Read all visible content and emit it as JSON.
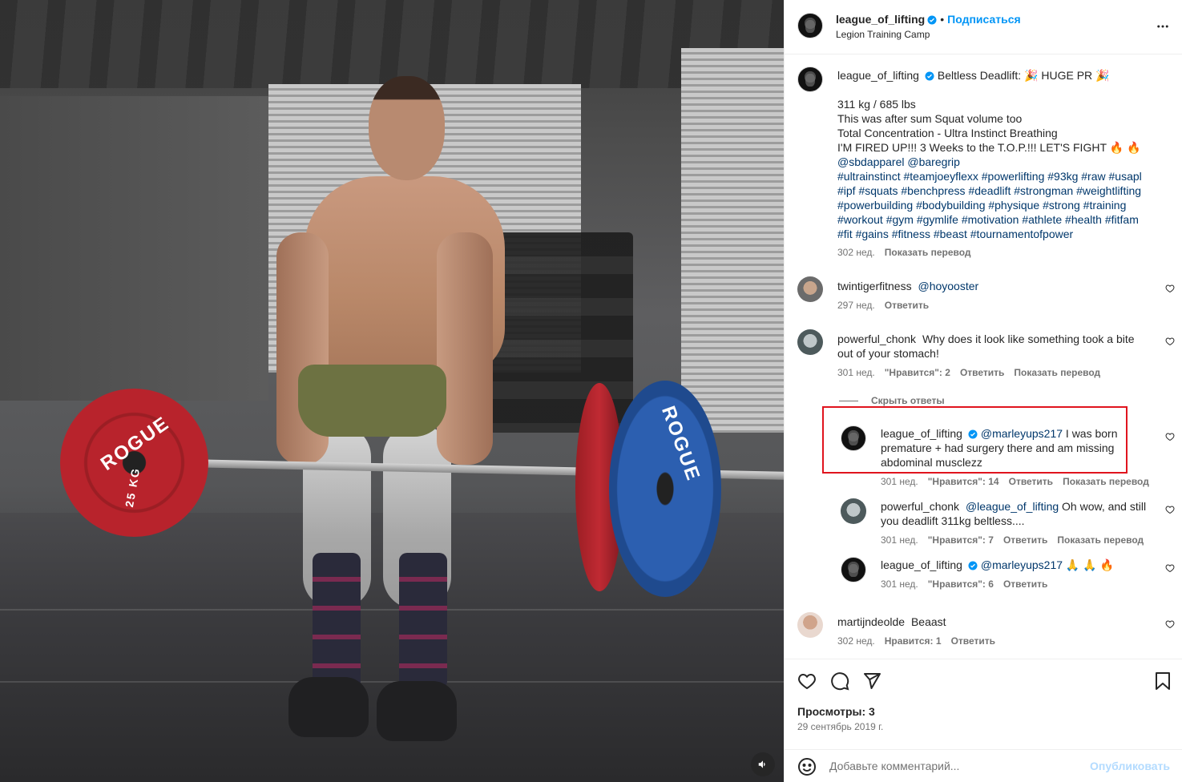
{
  "post": {
    "author": "league_of_lifting",
    "follow_label": "Подписаться",
    "location": "Legion Training Camp",
    "media_alt": "Video of a man deadlifting a barbell with Rogue plates",
    "plate_brand": "ROGUE",
    "plate_weight": "25 KG"
  },
  "caption": {
    "username": "league_of_lifting",
    "lines": [
      "Beltless Deadlift: 🎉 HUGE PR 🎉",
      "",
      "311 kg / 685 lbs",
      "This was after sum Squat volume too",
      "Total Concentration - Ultra Instinct Breathing",
      "I'M FIRED UP!!! 3 Weeks to the T.O.P.!!! LET'S FIGHT 🔥 🔥"
    ],
    "mentions": "@sbdapparel @baregrip",
    "hashtags": [
      "#ultrainstinct #teamjoeyflexx #powerlifting #93kg #raw #usapl",
      "#ipf #squats #benchpress #deadlift #strongman #weightlifting",
      "#powerbuilding #bodybuilding #physique #strong #training",
      "#workout #gym #gymlife #motivation #athlete #health #fitfam",
      "#fit #gains #fitness #beast #tournamentofpower"
    ],
    "time": "302 нед.",
    "translate": "Показать перевод"
  },
  "comments": [
    {
      "username": "twintigerfitness",
      "mention": "@hoyooster",
      "text": "",
      "time": "297 нед.",
      "likes": "",
      "reply": "Ответить",
      "translate": ""
    },
    {
      "username": "powerful_chonk",
      "mention": "",
      "text_line1": "Why does it look like something took a bite",
      "text_line2": "out of your stomach!",
      "time": "301 нед.",
      "likes": "\"Нравится\": 2",
      "reply": "Ответить",
      "translate": "Показать перевод"
    },
    {
      "username": "martijndeolde",
      "text": "Beaast",
      "time": "302 нед.",
      "likes": "Нравится: 1",
      "reply": "Ответить"
    }
  ],
  "hide_replies": "Скрыть ответы",
  "replies": [
    {
      "username": "league_of_lifting",
      "mention": "@marleyups217",
      "text_line1a": "I was born",
      "text_line2": "premature + had surgery there and am missing",
      "text_line3": "abdominal musclezz",
      "time": "301 нед.",
      "likes": "\"Нравится\": 14",
      "reply": "Ответить",
      "translate": "Показать перевод"
    },
    {
      "username": "powerful_chonk",
      "mention": "@league_of_lifting",
      "text_line1a": "Oh wow, and still",
      "text_line2": "you deadlift 311kg beltless....",
      "time": "301 нед.",
      "likes": "\"Нравится\": 7",
      "reply": "Ответить",
      "translate": "Показать перевод"
    },
    {
      "username": "league_of_lifting",
      "mention": "@marleyups217",
      "text": "🙏 🙏 🔥",
      "time": "301 нед.",
      "likes": "\"Нравится\": 6",
      "reply": "Ответить"
    }
  ],
  "stats": {
    "views": "Просмотры: 3",
    "date": "29 сентябрь 2019 г."
  },
  "composer": {
    "placeholder": "Добавьте комментарий...",
    "publish": "Опубликовать"
  },
  "icons": {
    "like": "heart-icon",
    "comment": "comment-icon",
    "share": "send-icon",
    "save": "bookmark-icon",
    "emoji": "emoji-icon",
    "more": "more-icon",
    "mute": "volume-icon",
    "verified": "verified-badge-icon"
  },
  "colors": {
    "link": "#0095f6",
    "mention": "#00376b",
    "verified": "#0095f6",
    "highlight_border": "#e0141e",
    "publish_disabled": "#b3dbff"
  }
}
